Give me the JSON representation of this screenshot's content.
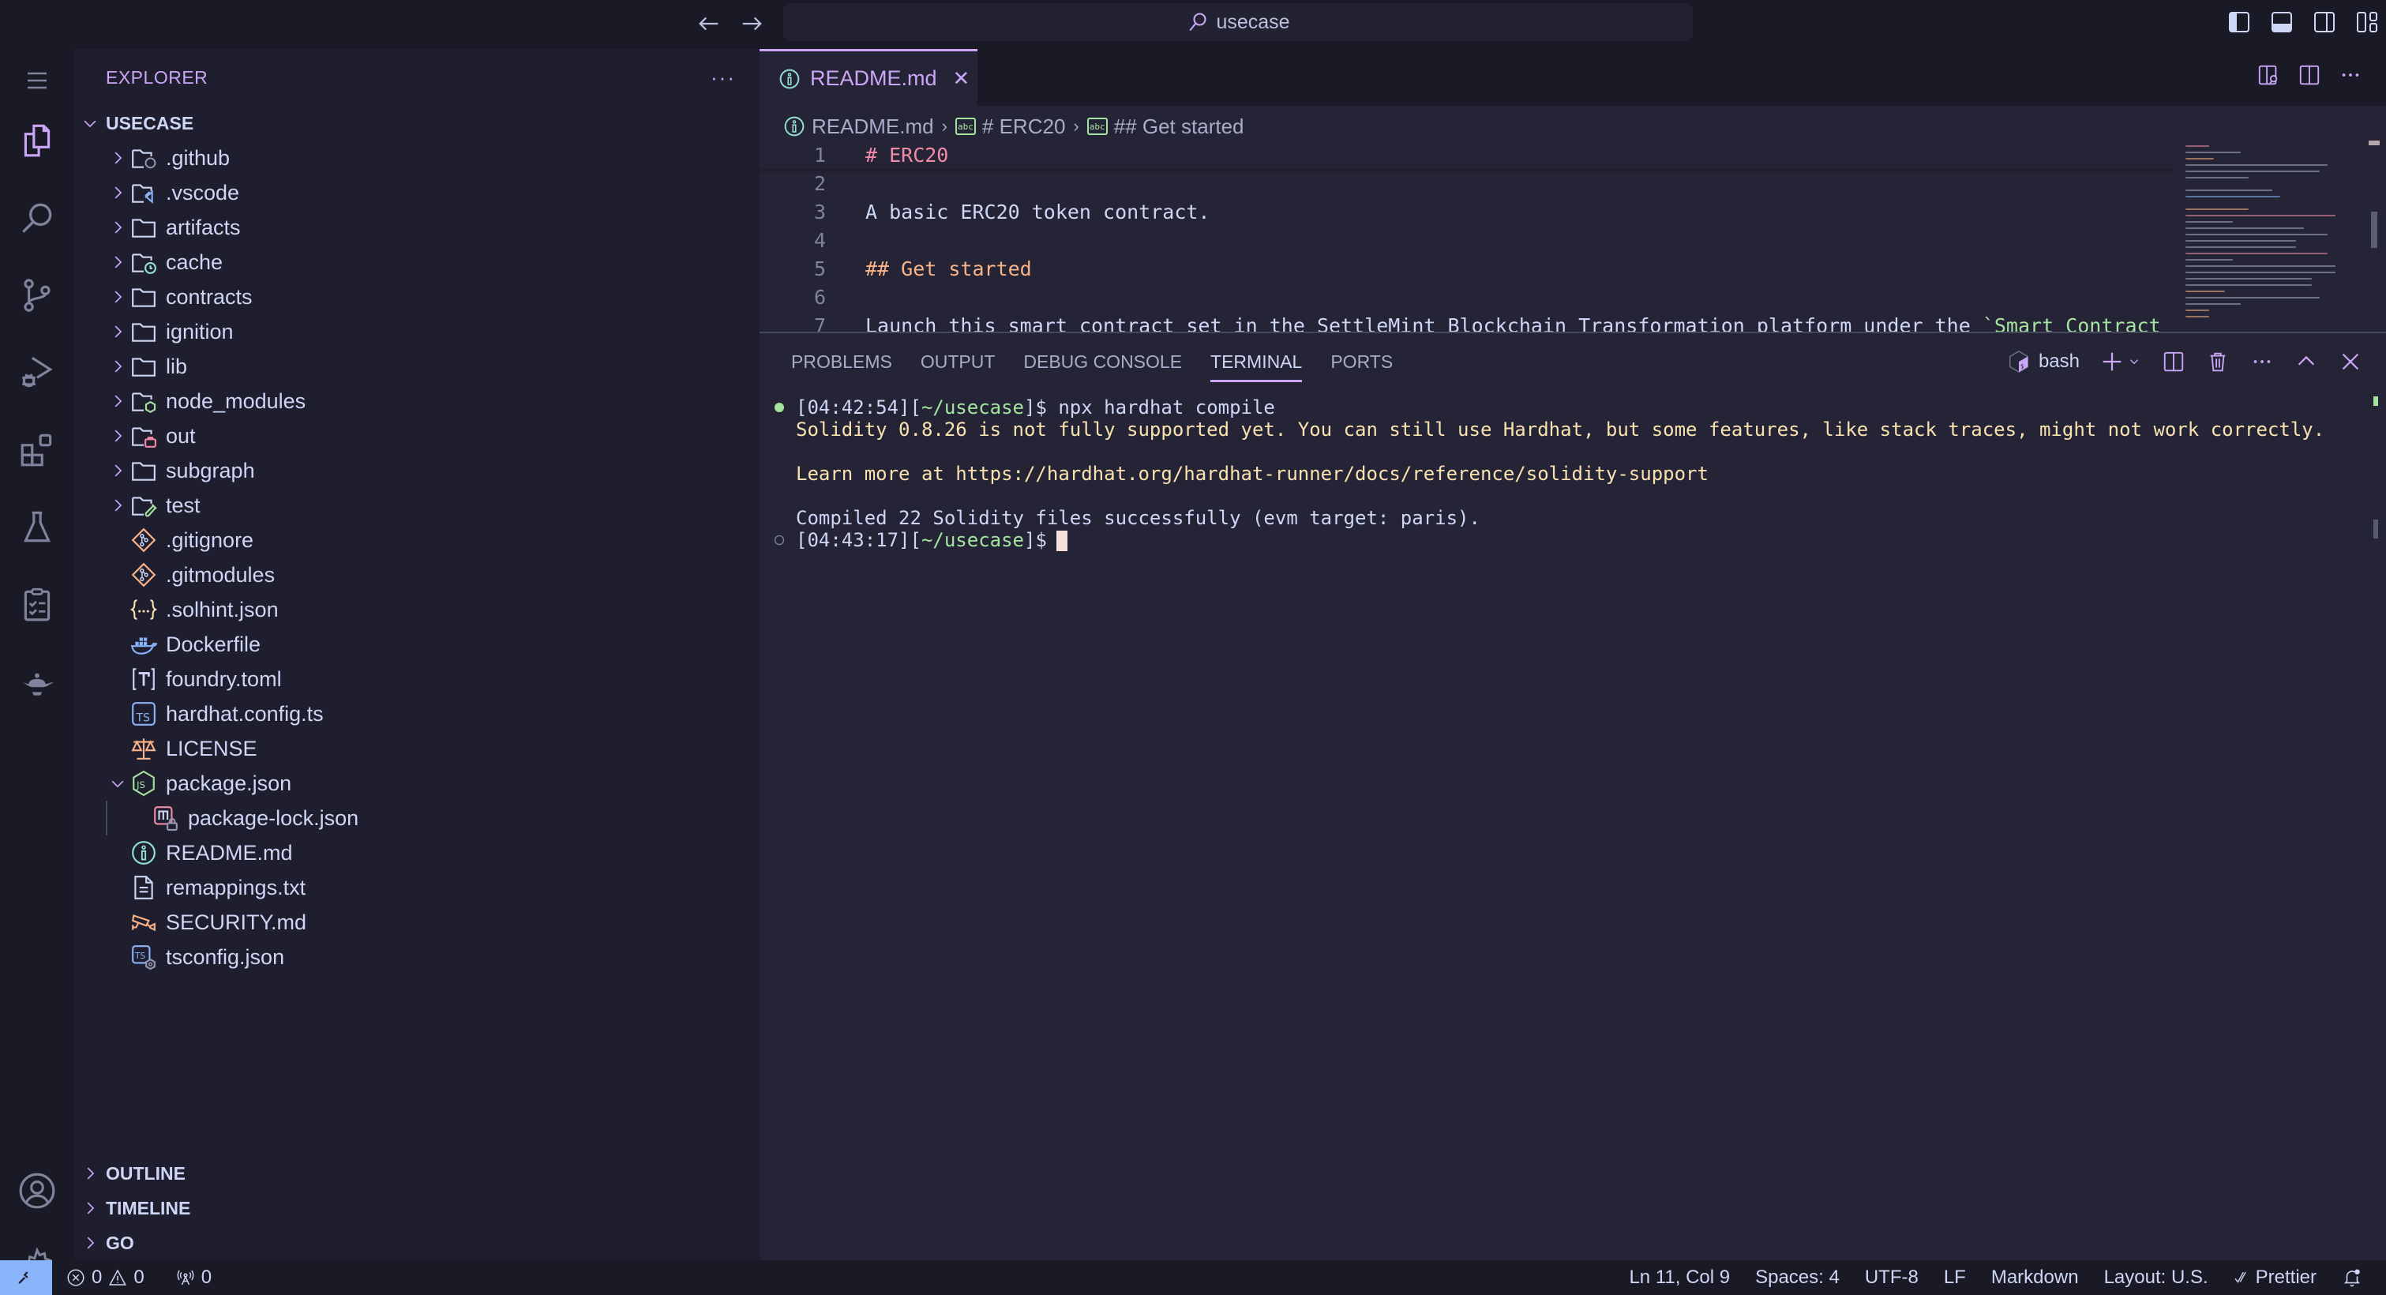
{
  "titlebar": {
    "search_text": "usecase",
    "back_icon": "arrow-left-icon",
    "forward_icon": "arrow-right-icon",
    "layout_icons": [
      "toggle-primary-sidebar-icon",
      "toggle-panel-icon",
      "toggle-secondary-sidebar-icon",
      "customize-layout-icon"
    ]
  },
  "activity_bar": {
    "top": [
      {
        "name": "menu",
        "icon": "hamburger-menu-icon"
      },
      {
        "name": "explorer",
        "icon": "files-icon",
        "active": true
      },
      {
        "name": "search",
        "icon": "search-icon"
      },
      {
        "name": "source-control",
        "icon": "source-control-icon"
      },
      {
        "name": "run-debug",
        "icon": "run-debug-icon"
      },
      {
        "name": "extensions",
        "icon": "extensions-icon"
      },
      {
        "name": "testing",
        "icon": "flask-icon"
      },
      {
        "name": "tasks",
        "icon": "checklist-icon"
      },
      {
        "name": "genie",
        "icon": "genie-lamp-icon"
      }
    ],
    "bottom": [
      {
        "name": "accounts",
        "icon": "account-icon"
      },
      {
        "name": "manage",
        "icon": "gear-icon"
      }
    ]
  },
  "sidebar": {
    "title": "EXPLORER",
    "more": "···",
    "root": "USECASE",
    "tree": [
      {
        "label": ".github",
        "type": "folder",
        "icon": "folder-github-icon",
        "expanded": false
      },
      {
        "label": ".vscode",
        "type": "folder",
        "icon": "folder-vscode-icon",
        "expanded": false
      },
      {
        "label": "artifacts",
        "type": "folder",
        "icon": "folder-icon",
        "expanded": false
      },
      {
        "label": "cache",
        "type": "folder",
        "icon": "folder-cache-icon",
        "expanded": false
      },
      {
        "label": "contracts",
        "type": "folder",
        "icon": "folder-icon",
        "expanded": false
      },
      {
        "label": "ignition",
        "type": "folder",
        "icon": "folder-icon",
        "expanded": false
      },
      {
        "label": "lib",
        "type": "folder",
        "icon": "folder-icon",
        "expanded": false
      },
      {
        "label": "node_modules",
        "type": "folder",
        "icon": "folder-node-icon",
        "expanded": false
      },
      {
        "label": "out",
        "type": "folder",
        "icon": "folder-out-icon",
        "expanded": false
      },
      {
        "label": "subgraph",
        "type": "folder",
        "icon": "folder-icon",
        "expanded": false
      },
      {
        "label": "test",
        "type": "folder",
        "icon": "folder-test-icon",
        "expanded": false
      },
      {
        "label": ".gitignore",
        "type": "file",
        "icon": "git-icon"
      },
      {
        "label": ".gitmodules",
        "type": "file",
        "icon": "git-icon"
      },
      {
        "label": ".solhint.json",
        "type": "file",
        "icon": "json-icon"
      },
      {
        "label": "Dockerfile",
        "type": "file",
        "icon": "docker-icon"
      },
      {
        "label": "foundry.toml",
        "type": "file",
        "icon": "toml-icon"
      },
      {
        "label": "hardhat.config.ts",
        "type": "file",
        "icon": "typescript-icon"
      },
      {
        "label": "LICENSE",
        "type": "file",
        "icon": "license-scale-icon"
      },
      {
        "label": "package.json",
        "type": "file",
        "icon": "nodejs-icon",
        "expanded": true
      },
      {
        "label": "package-lock.json",
        "type": "file",
        "icon": "package-lock-icon",
        "nested": true
      },
      {
        "label": "README.md",
        "type": "file",
        "icon": "info-icon"
      },
      {
        "label": "remappings.txt",
        "type": "file",
        "icon": "text-file-icon"
      },
      {
        "label": "SECURITY.md",
        "type": "file",
        "icon": "security-camera-icon"
      },
      {
        "label": "tsconfig.json",
        "type": "file",
        "icon": "tsconfig-icon"
      }
    ],
    "sections": [
      "OUTLINE",
      "TIMELINE",
      "GO"
    ]
  },
  "editor": {
    "tab": {
      "label": "README.md",
      "close": "✕",
      "icon": "info-icon"
    },
    "actions": [
      "open-preview-to-side-icon",
      "split-editor-icon",
      "more-actions-icon"
    ],
    "breadcrumb": [
      {
        "label": "README.md",
        "icon": "info-icon"
      },
      {
        "label": "# ERC20",
        "icon": "abc-string-icon"
      },
      {
        "label": "## Get started",
        "icon": "abc-string-icon"
      }
    ],
    "lines": [
      {
        "n": "1",
        "segments": [
          {
            "t": "# ERC20",
            "c": "h1"
          }
        ]
      },
      {
        "n": "2",
        "segments": []
      },
      {
        "n": "3",
        "segments": [
          {
            "t": "A basic ERC20 token contract.",
            "c": "text"
          }
        ]
      },
      {
        "n": "4",
        "segments": []
      },
      {
        "n": "5",
        "segments": [
          {
            "t": "## Get started",
            "c": "h2"
          }
        ]
      },
      {
        "n": "6",
        "segments": []
      },
      {
        "n": "7",
        "segments": [
          {
            "t": "Launch this smart contract set in the SettleMint Blockchain Transformation platform under the ",
            "c": "text"
          },
          {
            "t": "`Smart Contract",
            "c": "code"
          }
        ]
      }
    ]
  },
  "panel": {
    "tabs": [
      {
        "label": "PROBLEMS",
        "active": false
      },
      {
        "label": "OUTPUT",
        "active": false
      },
      {
        "label": "DEBUG CONSOLE",
        "active": false
      },
      {
        "label": "TERMINAL",
        "active": true
      },
      {
        "label": "PORTS",
        "active": false
      }
    ],
    "shell": "bash",
    "actions": [
      "new-terminal-icon",
      "launch-profile-chevron-icon",
      "split-terminal-icon",
      "kill-terminal-icon",
      "more-actions-icon",
      "maximize-panel-icon",
      "close-panel-icon"
    ],
    "terminal": [
      {
        "dot": "success",
        "segments": [
          {
            "t": "[04:42:54]",
            "c": "ts"
          },
          {
            "t": "[",
            "c": "ts"
          },
          {
            "t": "~/usecase",
            "c": "path"
          },
          {
            "t": "]$ npx hardhat compile",
            "c": "ts"
          }
        ]
      },
      {
        "dot": "",
        "segments": [
          {
            "t": "Solidity 0.8.26 is not fully supported yet. You can still use Hardhat, but some features, like stack traces, might not work correctly.",
            "c": "warn"
          }
        ]
      },
      {
        "dot": "",
        "segments": []
      },
      {
        "dot": "",
        "segments": [
          {
            "t": "Learn more at https://hardhat.org/hardhat-runner/docs/reference/solidity-support",
            "c": "warn"
          }
        ]
      },
      {
        "dot": "",
        "segments": []
      },
      {
        "dot": "",
        "segments": [
          {
            "t": "Compiled 22 Solidity files successfully (evm target: paris).",
            "c": "plain"
          }
        ]
      },
      {
        "dot": "idle",
        "segments": [
          {
            "t": "[04:43:17]",
            "c": "ts"
          },
          {
            "t": "[",
            "c": "ts"
          },
          {
            "t": "~/usecase",
            "c": "path"
          },
          {
            "t": "]$",
            "c": "ts"
          }
        ],
        "cursor": true
      }
    ]
  },
  "statusbar": {
    "remote_icon": "remote-icon",
    "errors": "0",
    "warnings": "0",
    "ports": "0",
    "position": "Ln 11, Col 9",
    "indent": "Spaces: 4",
    "encoding": "UTF-8",
    "eol": "LF",
    "language": "Markdown",
    "keyboard": "Layout: U.S.",
    "formatter": "Prettier",
    "notifications_icon": "bell-dot-icon"
  },
  "colors": {
    "accent": "#cba6f7",
    "heading1": "#f38ba8",
    "heading2": "#fab387",
    "code": "#a6e3a1",
    "warning_text": "#f9e2af",
    "remote_bg": "#89b4fa"
  }
}
